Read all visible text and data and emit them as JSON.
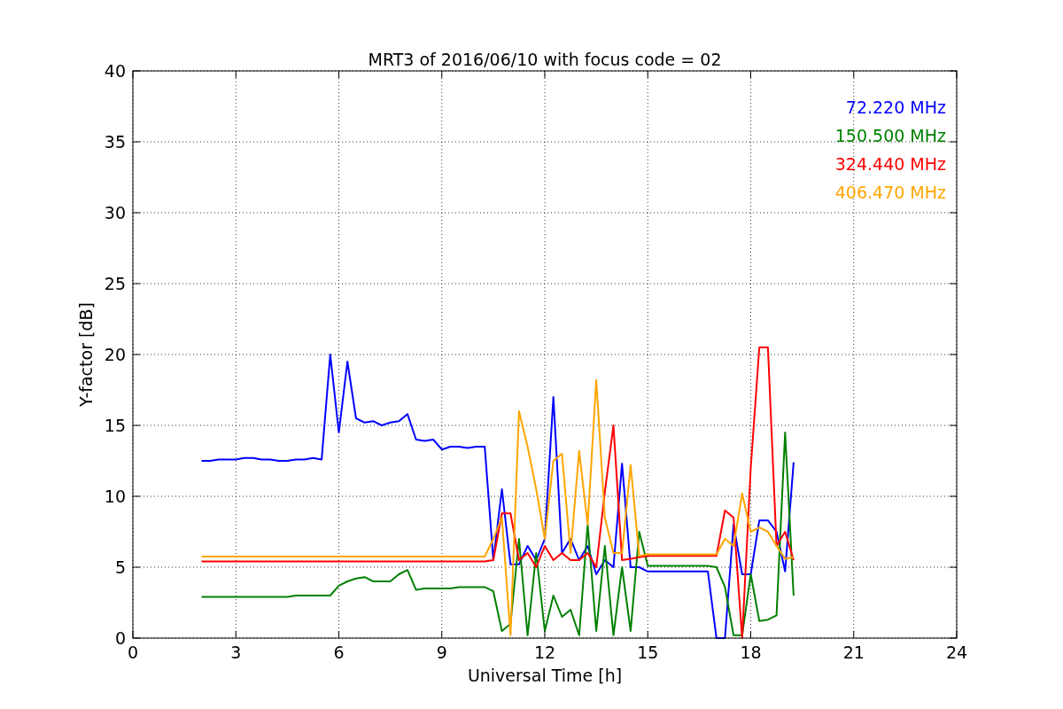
{
  "figure": {
    "chart_data": {
      "type": "line",
      "title": "MRT3 of 2016/06/10 with focus code = 02",
      "xlabel": "Universal Time [h]",
      "ylabel": "Y-factor [dB]",
      "x": [
        2,
        2.25,
        2.5,
        2.75,
        3,
        3.25,
        3.5,
        3.75,
        4,
        4.25,
        4.5,
        4.75,
        5,
        5.25,
        5.5,
        5.75,
        6,
        6.25,
        6.5,
        6.75,
        7,
        7.25,
        7.5,
        7.75,
        8,
        8.25,
        8.5,
        8.75,
        9,
        9.25,
        9.5,
        9.75,
        10,
        10.25,
        10.5,
        10.75,
        11,
        11.25,
        11.5,
        11.75,
        12,
        12.25,
        12.5,
        12.75,
        13,
        13.25,
        13.5,
        13.75,
        14,
        14.25,
        14.5,
        14.75,
        15,
        15.25,
        15.5,
        15.75,
        16,
        16.25,
        16.5,
        16.75,
        17,
        17.25,
        17.5,
        17.75,
        18,
        18.25,
        18.5,
        18.75,
        19,
        19.25
      ],
      "series": [
        {
          "name": "72.220 MHz",
          "color": "#0000ff",
          "values": [
            12.5,
            12.5,
            12.6,
            12.6,
            12.6,
            12.7,
            12.7,
            12.6,
            12.6,
            12.5,
            12.5,
            12.6,
            12.6,
            12.7,
            12.6,
            20,
            14.5,
            19.5,
            15.5,
            15.2,
            15.3,
            15.0,
            15.2,
            15.3,
            15.8,
            14.0,
            13.9,
            14.0,
            13.3,
            13.5,
            13.5,
            13.4,
            13.5,
            13.5,
            5.5,
            10.5,
            5.2,
            5.2,
            6.5,
            5.5,
            7,
            17,
            6,
            7,
            5.5,
            6.5,
            4.5,
            5.5,
            5,
            12.3,
            5,
            5,
            4.7,
            4.7,
            4.7,
            4.7,
            4.7,
            4.7,
            4.7,
            4.7,
            0,
            0,
            8,
            4.5,
            4.5,
            8.3,
            8.3,
            7.5,
            4.7,
            12.4
          ]
        },
        {
          "name": "150.500 MHz",
          "color": "#008000",
          "values": [
            2.9,
            2.9,
            2.9,
            2.9,
            2.9,
            2.9,
            2.9,
            2.9,
            2.9,
            2.9,
            2.9,
            3.0,
            3.0,
            3.0,
            3.0,
            3.0,
            3.7,
            4.0,
            4.2,
            4.3,
            4.0,
            4.0,
            4.0,
            4.5,
            4.8,
            3.4,
            3.5,
            3.5,
            3.5,
            3.5,
            3.6,
            3.6,
            3.6,
            3.6,
            3.3,
            0.5,
            1,
            7,
            0.2,
            6,
            0.5,
            3,
            1.5,
            2,
            0.2,
            8,
            0.5,
            6.5,
            0.2,
            5,
            0.5,
            7.5,
            5.1,
            5.1,
            5.1,
            5.1,
            5.1,
            5.1,
            5.1,
            5.1,
            5,
            3.6,
            0.2,
            0.2,
            4.5,
            1.2,
            1.3,
            1.6,
            14.5,
            3
          ]
        },
        {
          "name": "324.440 MHz",
          "color": "#ff0000",
          "values": [
            5.4,
            5.4,
            5.4,
            5.4,
            5.4,
            5.4,
            5.4,
            5.4,
            5.4,
            5.4,
            5.4,
            5.4,
            5.4,
            5.4,
            5.4,
            5.4,
            5.4,
            5.4,
            5.4,
            5.4,
            5.4,
            5.4,
            5.4,
            5.4,
            5.4,
            5.4,
            5.4,
            5.4,
            5.4,
            5.4,
            5.4,
            5.4,
            5.4,
            5.4,
            5.5,
            8.8,
            8.8,
            5.5,
            6,
            5,
            6.5,
            5.5,
            6,
            5.5,
            5.5,
            6,
            5,
            10.3,
            15,
            5.5,
            5.6,
            5.7,
            5.8,
            5.8,
            5.8,
            5.8,
            5.8,
            5.8,
            5.8,
            5.8,
            5.8,
            9,
            8.5,
            0,
            12,
            20.5,
            20.5,
            6.5,
            7.5,
            5.5
          ]
        },
        {
          "name": "406.470 MHz",
          "color": "#ffa500",
          "values": [
            5.75,
            5.75,
            5.75,
            5.75,
            5.75,
            5.75,
            5.75,
            5.75,
            5.75,
            5.75,
            5.75,
            5.75,
            5.75,
            5.75,
            5.75,
            5.75,
            5.75,
            5.75,
            5.75,
            5.75,
            5.75,
            5.75,
            5.75,
            5.75,
            5.75,
            5.75,
            5.75,
            5.75,
            5.75,
            5.75,
            5.75,
            5.75,
            5.75,
            5.75,
            7,
            8.5,
            0.2,
            16,
            13.5,
            10.5,
            7,
            12.5,
            13,
            6,
            13.2,
            8,
            18.2,
            8.5,
            6,
            6,
            12.2,
            5.8,
            5.9,
            5.9,
            5.9,
            5.9,
            5.9,
            5.9,
            5.9,
            5.9,
            5.9,
            7,
            6.5,
            10.2,
            7.5,
            7.8,
            7.5,
            6.5,
            5.6,
            5.7
          ]
        }
      ],
      "grid": true,
      "xlim": [
        0,
        24
      ],
      "ylim": [
        0,
        40
      ],
      "xticks": [
        0,
        3,
        6,
        9,
        12,
        15,
        18,
        21,
        24
      ],
      "yticks": [
        0,
        5,
        10,
        15,
        20,
        25,
        30,
        35,
        40
      ]
    }
  }
}
